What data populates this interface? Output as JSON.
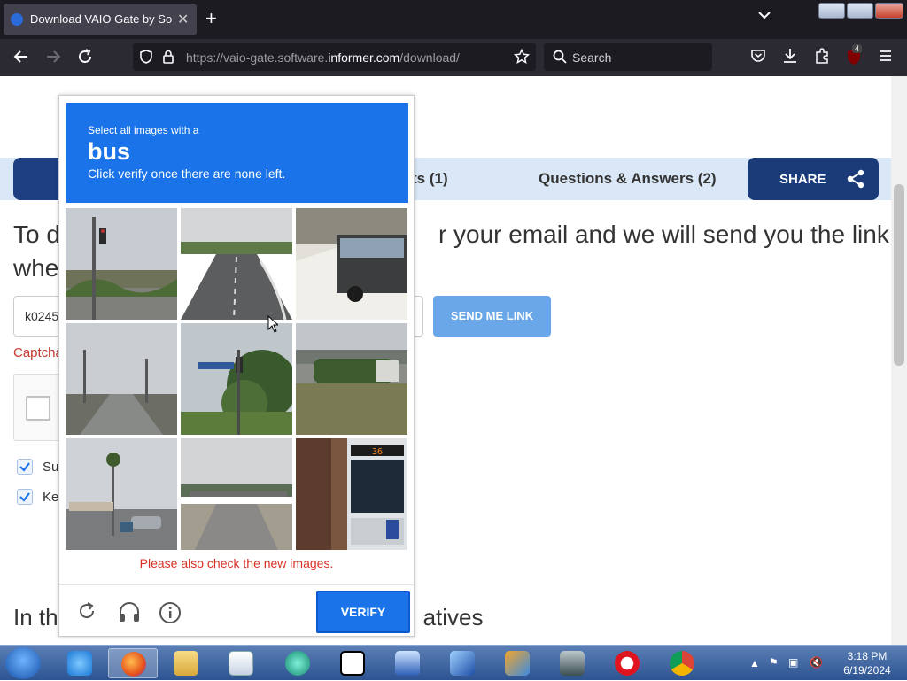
{
  "browser": {
    "tab_title": "Download VAIO Gate by Sony C",
    "url_prefix": "https://vaio-gate.software.",
    "url_domain": "informer.com",
    "url_suffix": "/download/",
    "search_placeholder": "Search",
    "extension_badge": "4"
  },
  "page": {
    "tab_points": "ts (1)",
    "tab_qa": "Questions & Answers (2)",
    "share_label": "SHARE",
    "heading_line1": "To d",
    "heading_line1_end": "r your email and we will send you the link",
    "heading_line2": "whe",
    "email_value": "k0245",
    "send_button": "SEND ME LINK",
    "captcha_error": "Captcha",
    "check1_label": "Su",
    "check2_label": "Ke",
    "bottom_heading_start": "In th",
    "bottom_heading_end": "atives"
  },
  "challenge": {
    "line1": "Select all images with a",
    "target": "bus",
    "line3": "Click verify once there are none left.",
    "new_images_notice": "Please also check the new images.",
    "verify_button": "VERIFY",
    "tiles": [
      {
        "scene": "traffic light and street lamp at intersection"
      },
      {
        "scene": "empty road with lane markings"
      },
      {
        "scene": "city bus on snowy street"
      },
      {
        "scene": "road with utility poles"
      },
      {
        "scene": "traffic light with street sign and tree"
      },
      {
        "scene": "hedge and parked cars"
      },
      {
        "scene": "parking lot with palm tree"
      },
      {
        "scene": "overpass over road"
      },
      {
        "scene": "city bus front with route display"
      }
    ]
  },
  "taskbar": {
    "time": "3:18 PM",
    "date": "6/19/2024"
  },
  "colors": {
    "accent": "#1a73e8",
    "share_bg": "#1b3a78",
    "send_btn": "#6aa7e8",
    "error": "#d93025"
  }
}
